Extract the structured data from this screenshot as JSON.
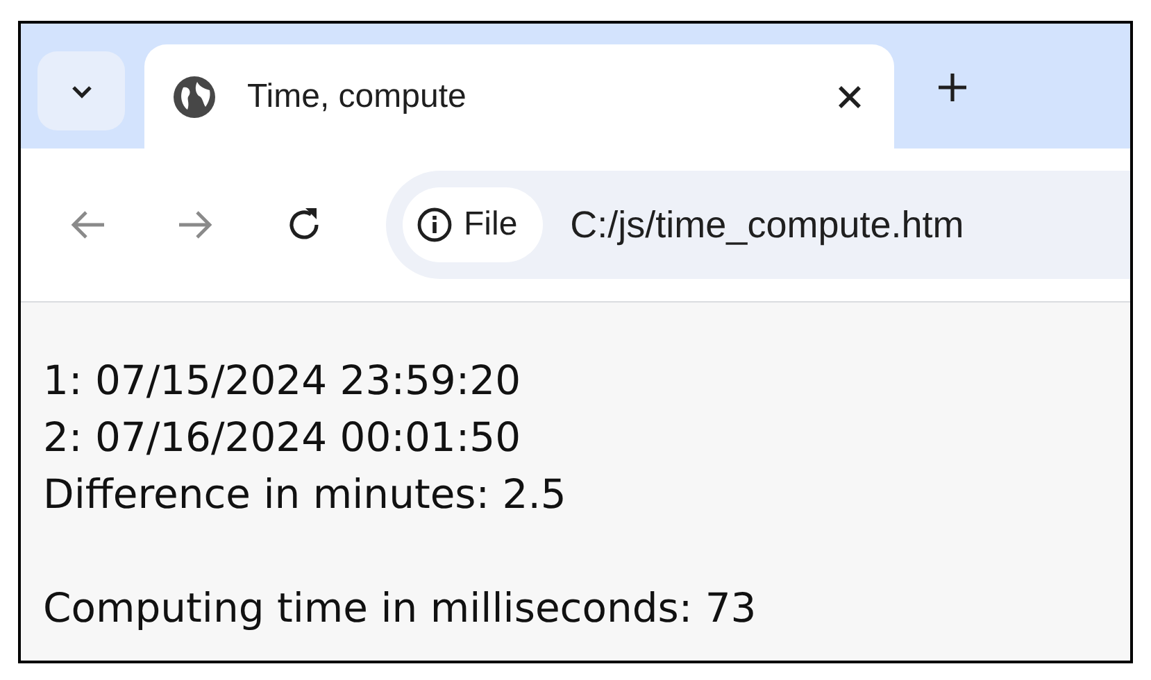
{
  "tabs": [
    {
      "title": "Time, compute",
      "selected": true
    }
  ],
  "address_bar": {
    "security_chip": "File",
    "url": "C:/js/time_compute.htm"
  },
  "page": {
    "paragraphs": [
      {
        "lines": [
          "1: 07/15/2024 23:59:20",
          "2: 07/16/2024 00:01:50",
          "Difference in minutes: 2.5"
        ]
      },
      {
        "lines": [
          "Computing time in milliseconds: 73"
        ]
      }
    ]
  }
}
